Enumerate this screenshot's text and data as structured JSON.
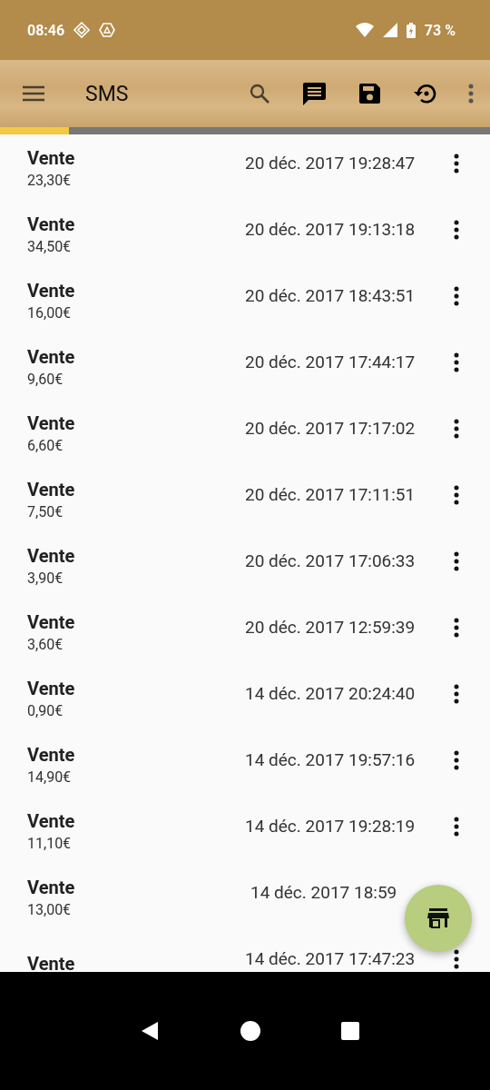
{
  "status_bar": {
    "time": "08:46",
    "battery": "73 %"
  },
  "toolbar": {
    "title": "SMS"
  },
  "progress": {
    "level": 0.14
  },
  "rows": [
    {
      "title": "Vente",
      "amount": "23,30€",
      "date": "20 déc. 2017 19:28:47",
      "menu": true
    },
    {
      "title": "Vente",
      "amount": "34,50€",
      "date": "20 déc. 2017 19:13:18",
      "menu": true
    },
    {
      "title": "Vente",
      "amount": "16,00€",
      "date": "20 déc. 2017 18:43:51",
      "menu": true
    },
    {
      "title": "Vente",
      "amount": "9,60€",
      "date": "20 déc. 2017 17:44:17",
      "menu": true
    },
    {
      "title": "Vente",
      "amount": "6,60€",
      "date": "20 déc. 2017 17:17:02",
      "menu": true
    },
    {
      "title": "Vente",
      "amount": "7,50€",
      "date": "20 déc. 2017 17:11:51",
      "menu": true
    },
    {
      "title": "Vente",
      "amount": "3,90€",
      "date": "20 déc. 2017 17:06:33",
      "menu": true
    },
    {
      "title": "Vente",
      "amount": "3,60€",
      "date": "20 déc. 2017 12:59:39",
      "menu": true
    },
    {
      "title": "Vente",
      "amount": "0,90€",
      "date": "14 déc. 2017 20:24:40",
      "menu": true
    },
    {
      "title": "Vente",
      "amount": "14,90€",
      "date": "14 déc. 2017 19:57:16",
      "menu": true
    },
    {
      "title": "Vente",
      "amount": "11,10€",
      "date": "14 déc. 2017 19:28:19",
      "menu": true
    },
    {
      "title": "Vente",
      "amount": "13,00€",
      "date": "14 déc. 2017 18:59",
      "menu": false
    },
    {
      "title": "Vente",
      "date": "14 déc. 2017 17:47:23",
      "menu": true
    }
  ]
}
